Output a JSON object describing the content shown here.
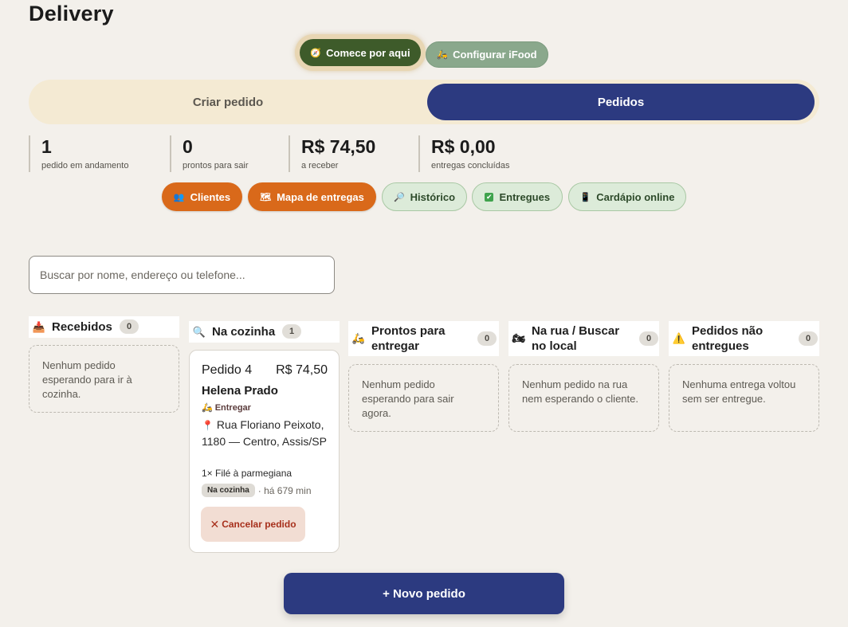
{
  "page": {
    "title": "Delivery"
  },
  "top_buttons": {
    "start": {
      "icon": "compass-icon",
      "label": "Comece por aqui"
    },
    "ifood": {
      "icon": "scooter-icon",
      "label": "Configurar iFood"
    }
  },
  "tabs": {
    "create": "Criar pedido",
    "orders": "Pedidos",
    "active": "Pedidos"
  },
  "stats": [
    {
      "value": "1",
      "label": "pedido em andamento"
    },
    {
      "value": "0",
      "label": "prontos para sair"
    },
    {
      "value": "R$ 74,50",
      "label": "a receber"
    },
    {
      "value": "R$ 0,00",
      "label": "entregas concluídas"
    }
  ],
  "actions": [
    {
      "icon": "people-icon",
      "label": "Clientes"
    },
    {
      "icon": "map-icon",
      "label": "Mapa de entregas"
    },
    {
      "icon": "magnifier-icon",
      "label": "Histórico"
    },
    {
      "icon": "check-icon",
      "label": "Entregues"
    },
    {
      "icon": "phone-menu-icon",
      "label": "Cardápio online"
    }
  ],
  "search": {
    "placeholder": "Buscar por nome, endereço ou telefone...",
    "value": ""
  },
  "columns": [
    {
      "icon": "inbox-icon",
      "title": "Recebidos",
      "count": "0",
      "empty": "Nenhum pedido esperando para ir à cozinha."
    },
    {
      "icon": "magnifier-icon",
      "title": "Na cozinha",
      "count": "1",
      "empty": ""
    },
    {
      "icon": "scooter-icon",
      "title": "Prontos para entregar",
      "count": "0",
      "empty": "Nenhum pedido esperando para sair agora."
    },
    {
      "icon": "motorcycle-icon",
      "title": "Na rua / Buscar no local",
      "count": "0",
      "empty": "Nenhum pedido na rua nem esperando o cliente."
    },
    {
      "icon": "warning-icon",
      "title": "Pedidos não entregues",
      "count": "0",
      "empty": "Nenhuma entrega voltou sem ser entregue."
    }
  ],
  "order": {
    "id": "Pedido 4",
    "price": "R$ 74,50",
    "customer": "Helena Prado",
    "type": "Entregar",
    "address": "Rua Floriano Peixoto, 1180 — Centro, Assis/SP",
    "items": "1× Filé à parmegiana",
    "status": "Na cozinha",
    "elapsed": "· há 679 min",
    "cancel_label": "Cancelar pedido"
  },
  "new_order_label": "+ Novo pedido",
  "colors": {
    "navy": "#2c3a80",
    "orange": "#d9691a",
    "green_dark": "#3e5b2a",
    "cancel_text": "#a7301c"
  }
}
